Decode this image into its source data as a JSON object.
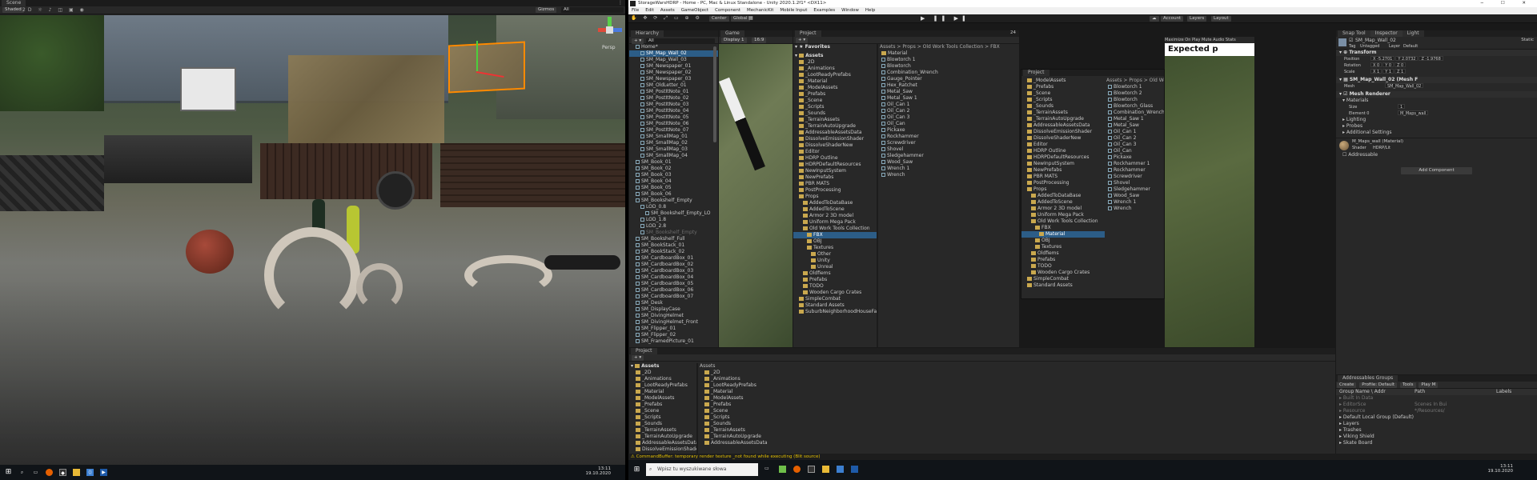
{
  "colors": {
    "selection": "#2c5d87",
    "accent": "#ff8a00",
    "warning": "#e5c100",
    "folder": "#c9a84e"
  },
  "left": {
    "tab_scene": "Scene",
    "shading": "Shaded",
    "gizmos": "Gizmos",
    "search_value": "All",
    "view_mode": "Persp",
    "taskbar_time": "13:11",
    "taskbar_date": "19.10.2020"
  },
  "right": {
    "title": "StorageWarsHDRP - Home - PC, Mac & Linux Standalone - Unity 2020.1.2f1* <DX11>",
    "menu": [
      "File",
      "Edit",
      "Assets",
      "GameObject",
      "Component",
      "MechanicKit",
      "Mobile Input",
      "Examples",
      "Window",
      "Help"
    ],
    "toolbar": {
      "center": "Center",
      "global": "Global",
      "account": "Account",
      "layers": "Layers",
      "layout": "Layout"
    },
    "hierarchy": {
      "tab": "Hierarchy",
      "search": "All",
      "root": "Home*",
      "items": [
        {
          "t": "SM_Map_Wall_02",
          "d": 2,
          "sel": true
        },
        {
          "t": "SM_Map_Wall_03",
          "d": 2
        },
        {
          "t": "SM_Newspaper_01",
          "d": 2
        },
        {
          "t": "SM_Newspaper_02",
          "d": 2
        },
        {
          "t": "SM_Newspaper_03",
          "d": 2
        },
        {
          "t": "SM_OldLetter_01",
          "d": 2
        },
        {
          "t": "SM_PostItNote_01",
          "d": 2
        },
        {
          "t": "SM_PostItNote_02",
          "d": 2
        },
        {
          "t": "SM_PostItNote_03",
          "d": 2
        },
        {
          "t": "SM_PostItNote_04",
          "d": 2
        },
        {
          "t": "SM_PostItNote_05",
          "d": 2
        },
        {
          "t": "SM_PostItNote_06",
          "d": 2
        },
        {
          "t": "SM_PostItNote_07",
          "d": 2
        },
        {
          "t": "SM_SmallMap_01",
          "d": 2
        },
        {
          "t": "SM_SmallMap_02",
          "d": 2
        },
        {
          "t": "SM_SmallMap_03",
          "d": 2
        },
        {
          "t": "SM_SmallMap_04",
          "d": 2
        },
        {
          "t": "SM_Book_01",
          "d": 1
        },
        {
          "t": "SM_Book_02",
          "d": 1
        },
        {
          "t": "SM_Book_03",
          "d": 1
        },
        {
          "t": "SM_Book_04",
          "d": 1
        },
        {
          "t": "SM_Book_05",
          "d": 1
        },
        {
          "t": "SM_Book_06",
          "d": 1
        },
        {
          "t": "SM_Bookshelf_Empty",
          "d": 1
        },
        {
          "t": "LOD_0.8",
          "d": 2
        },
        {
          "t": "SM_Bookshelf_Empty_LO",
          "d": 3
        },
        {
          "t": "LOD_1.8",
          "d": 2
        },
        {
          "t": "LOD_2.8",
          "d": 2
        },
        {
          "t": "SM_Bookshelf_Empty",
          "d": 2,
          "dim": true
        },
        {
          "t": "SM_Bookshelf_Full",
          "d": 1
        },
        {
          "t": "SM_BookStack_01",
          "d": 1
        },
        {
          "t": "SM_BookStack_02",
          "d": 1
        },
        {
          "t": "SM_CardboardBox_01",
          "d": 1
        },
        {
          "t": "SM_CardboardBox_02",
          "d": 1
        },
        {
          "t": "SM_CardboardBox_03",
          "d": 1
        },
        {
          "t": "SM_CardboardBox_04",
          "d": 1
        },
        {
          "t": "SM_CardboardBox_05",
          "d": 1
        },
        {
          "t": "SM_CardboardBox_06",
          "d": 1
        },
        {
          "t": "SM_CardboardBox_07",
          "d": 1
        },
        {
          "t": "SM_Desk",
          "d": 1
        },
        {
          "t": "SM_DisplayCase",
          "d": 1
        },
        {
          "t": "SM_DivingHelmet",
          "d": 1
        },
        {
          "t": "SM_DivingHelmet_Front",
          "d": 1
        },
        {
          "t": "SM_Flipper_01",
          "d": 1
        },
        {
          "t": "SM_Flipper_02",
          "d": 1
        },
        {
          "t": "SM_FramedPicture_01",
          "d": 1
        }
      ]
    },
    "game": {
      "tab": "Game",
      "display": "Display 1",
      "aspect": "16:9",
      "maximize": "Maximize On Play",
      "mute": "Mute Audio",
      "stats": "Stats",
      "gizmos": "Gizmos"
    },
    "project_top": {
      "tab": "Project",
      "favorites": "Favorites",
      "assets": "Assets",
      "tree": [
        {
          "t": "_2D",
          "d": 1
        },
        {
          "t": "_Animations",
          "d": 1
        },
        {
          "t": "_LootReadyPrefabs",
          "d": 1
        },
        {
          "t": "_Material",
          "d": 1
        },
        {
          "t": "_ModelAssets",
          "d": 1
        },
        {
          "t": "_Prefabs",
          "d": 1
        },
        {
          "t": "_Scene",
          "d": 1
        },
        {
          "t": "_Scripts",
          "d": 1
        },
        {
          "t": "_Sounds",
          "d": 1
        },
        {
          "t": "_TerrainAssets",
          "d": 1
        },
        {
          "t": "_TerrainAutoUpgrade",
          "d": 1
        },
        {
          "t": "AddressableAssetsData",
          "d": 1
        },
        {
          "t": "DissolveEmissionShader",
          "d": 1
        },
        {
          "t": "DissolveShaderNew",
          "d": 1
        },
        {
          "t": "Editor",
          "d": 1
        },
        {
          "t": "HDRP Outline",
          "d": 1
        },
        {
          "t": "HDRPDefaultResources",
          "d": 1
        },
        {
          "t": "NewInputSystem",
          "d": 1
        },
        {
          "t": "NewPrefabs",
          "d": 1
        },
        {
          "t": "PBR MATS",
          "d": 1
        },
        {
          "t": "PostProcessing",
          "d": 1
        },
        {
          "t": "Props",
          "d": 1
        },
        {
          "t": "AddedToDataBase",
          "d": 2
        },
        {
          "t": "AddedToScene",
          "d": 2
        },
        {
          "t": "Armor 2 3D model",
          "d": 2
        },
        {
          "t": "Uniform Mega Pack",
          "d": 2
        },
        {
          "t": "Old Work Tools Collection",
          "d": 2
        },
        {
          "t": "FBX",
          "d": 3,
          "sel": true
        },
        {
          "t": "OBJ",
          "d": 3
        },
        {
          "t": "Textures",
          "d": 3
        },
        {
          "t": "Other",
          "d": 4
        },
        {
          "t": "Unity",
          "d": 4
        },
        {
          "t": "Unreal",
          "d": 4
        },
        {
          "t": "Oldfiems",
          "d": 2
        },
        {
          "t": "Prefabs",
          "d": 2
        },
        {
          "t": "TODO",
          "d": 2
        },
        {
          "t": "Wooden Cargo Crates",
          "d": 2
        },
        {
          "t": "SimpleCombat",
          "d": 1
        },
        {
          "t": "Standard Assets",
          "d": 1
        },
        {
          "t": "SuburbNeighborhoodHouseFack",
          "d": 1
        }
      ],
      "breadcrumb": "Assets > Props > Old Work Tools Collection > FBX",
      "files": [
        "Material",
        "Blowtorch 1",
        "Blowtorch",
        "Combination_Wrench",
        "Gauge_Pointer",
        "Hex_Ratchet",
        "Metal_Saw",
        "Metal_Saw 1",
        "Oil_Can 1",
        "Oil_Can 2",
        "Oil_Can 3",
        "Oil_Can",
        "Pickaxe",
        "Rockhammer",
        "Screwdriver",
        "Shovel",
        "Sledgehammer",
        "Wood_Saw",
        "Wrench 1",
        "Wrench"
      ],
      "count": "24"
    },
    "project_float": {
      "tab": "Project",
      "tree": [
        "_ModelAssets",
        "_Prefabs",
        "_Scene",
        "_Scripts",
        "_Sounds",
        "_TerrainAssets",
        "_TerrainAutoUpgrade",
        "AddressableAssetsData",
        "DissolveEmissionShader",
        "DissolveShaderNew",
        "Editor",
        "HDRP Outline",
        "HDRPDefaultResources",
        "NewInputSystem",
        "NewPrefabs",
        "PBR MATS",
        "PostProcessing",
        "Props",
        "AddedToDataBase",
        "AddedToScene",
        "Armor 2 3D model",
        "Uniform Mega Pack",
        "Old Work Tools Collection",
        "FBX",
        "Material",
        "OBJ",
        "Textures",
        "Oldfiems",
        "Prefabs",
        "TODO",
        "Wooden Cargo Crates",
        "SimpleCombat",
        "Standard Assets"
      ],
      "depths": [
        1,
        1,
        1,
        1,
        1,
        1,
        1,
        1,
        1,
        1,
        1,
        1,
        1,
        1,
        1,
        1,
        1,
        1,
        2,
        2,
        2,
        2,
        2,
        3,
        4,
        3,
        3,
        2,
        2,
        2,
        2,
        1,
        1
      ],
      "breadcrumb": "Assets > Props > Old Work",
      "files": [
        "Blowtorch 1",
        "Blowtorch 2",
        "Blowtorch",
        "Blowtorch_Glass",
        "Combination_Wrench",
        "Metal_Saw 1",
        "Metal_Saw",
        "Oil_Can 1",
        "Oil_Can 2",
        "Oil_Can 3",
        "Oil_Can",
        "Pickaxe",
        "Rockhammer 1",
        "Rockhammer",
        "Screwdriver",
        "Shovel",
        "Sledgehammer",
        "Wood_Saw",
        "Wrench 1",
        "Wrench"
      ],
      "expected": "Expected p",
      "count": "24"
    },
    "inspector": {
      "tab_snap": "Snap Tool",
      "tab": "Inspector",
      "tab_light": "Light",
      "name": "SM_Map_Wall_02",
      "static": "Static",
      "tag_label": "Tag",
      "tag": "Untagged",
      "layer_label": "Layer",
      "layer": "Default",
      "transform": "Transform",
      "pos_label": "Position",
      "pos": [
        "X -5.2701",
        "Y 2.0732",
        "Z -1.9768"
      ],
      "rot_label": "Rotation",
      "rot": [
        "X 0",
        "Y 0",
        "Z 0"
      ],
      "scl_label": "Scale",
      "scl": [
        "X 1",
        "Y 1",
        "Z 1"
      ],
      "meshfilter": "SM_Map_Wall_02 (Mesh F",
      "mesh_label": "Mesh",
      "mesh": "SM_Map_Wall_02",
      "renderer": "Mesh Renderer",
      "materials": "Materials",
      "size_label": "Size",
      "size": "1",
      "elem_label": "Element 0",
      "elem": "M_Maps_wall",
      "lighting": "Lighting",
      "probes": "Probes",
      "additional": "Additional Settings",
      "material": "M_Maps_wall (Material)",
      "shader_label": "Shader",
      "shader": "HDRP/Lit",
      "addressable": "Addressable",
      "add_component": "Add Component"
    },
    "project_bottom": {
      "tab": "Project",
      "assets": "Assets",
      "tree": [
        "_2D",
        "_Animations",
        "_LootReadyPrefabs",
        "_Material",
        "_ModelAssets",
        "_Prefabs",
        "_Scene",
        "_Scripts",
        "_Sounds",
        "_TerrainAssets",
        "_TerrainAutoUpgrade",
        "AddressableAssetsData",
        "DissolveEmissionShader"
      ],
      "breadcrumb": "Assets",
      "files": [
        "_2D",
        "_Animations",
        "_LootReadyPrefabs",
        "_Material",
        "_ModelAssets",
        "_Prefabs",
        "_Scene",
        "_Scripts",
        "_Sounds",
        "_TerrainAssets",
        "_TerrainAutoUpgrade",
        "AddressableAssetsData"
      ]
    },
    "addressables": {
      "tab": "Addressables Groups",
      "create": "Create",
      "profile": "Profile: Default",
      "tools": "Tools",
      "play_mode": "Play M",
      "col_name": "Group Name \\ Addr",
      "col_path": "Path",
      "col_labels": "Labels",
      "rows": [
        "Built In Data",
        "EditorSce",
        "Resource",
        "Default Local Group (Default)",
        "Layers",
        "Trashes",
        "Viking Shield",
        "Skate Board"
      ],
      "row_paths": [
        "",
        "Scenes In Bui",
        "*/Resources/",
        "",
        "",
        "",
        "",
        ""
      ]
    },
    "status": "CommandBuffer: temporary render texture _not found while executing  (Blit source)",
    "taskbar": {
      "search": "Wpisz tu wyszukiwane słowa",
      "time": "13:11",
      "date": "19.10.2020"
    }
  }
}
